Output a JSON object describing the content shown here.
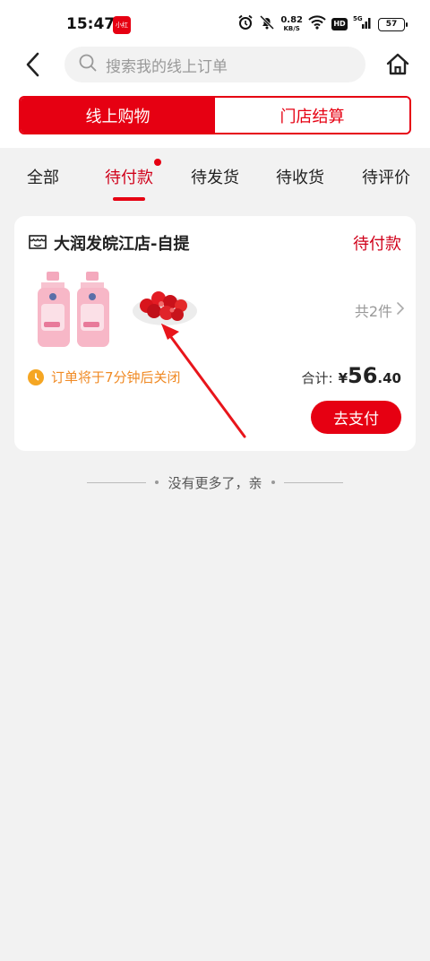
{
  "status_bar": {
    "time": "15:47",
    "app_badge": "小红鸭",
    "net_speed": "0.82",
    "net_unit": "KB/S",
    "hd": "HD",
    "signal": "5G",
    "battery": "57"
  },
  "header": {
    "search_placeholder": "搜索我的线上订单"
  },
  "segment": {
    "items": [
      {
        "label": "线上购物",
        "active": true
      },
      {
        "label": "门店结算",
        "active": false
      }
    ]
  },
  "tabs": [
    {
      "label": "全部"
    },
    {
      "label": "待付款",
      "active": true
    },
    {
      "label": "待发货"
    },
    {
      "label": "待收货"
    },
    {
      "label": "待评价"
    }
  ],
  "order": {
    "store_name": "大润发皖江店-自提",
    "status": "待付款",
    "item_count": "共2件",
    "countdown": "订单将于7分钟后关闭",
    "total_label": "合计:",
    "currency": "¥",
    "total_int": "56",
    "total_dec": ".40",
    "pay_label": "去支付"
  },
  "footer": {
    "no_more": "没有更多了，亲"
  },
  "colors": {
    "brand_red": "#e60012",
    "countdown_orange": "#f08a24"
  }
}
